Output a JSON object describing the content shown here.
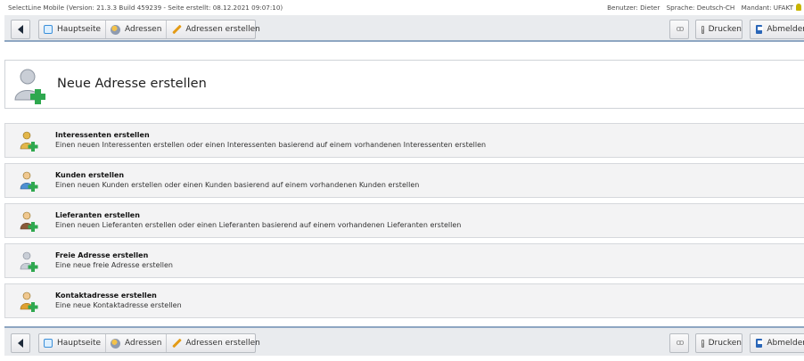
{
  "info_bar": {
    "version_text": "SelectLine Mobile (Version: 21.3.3 Build 459239 - Seite erstellt: 08.12.2021 09:07:10)",
    "user": "Benutzer: Dieter",
    "language": "Sprache: Deutsch-CH",
    "client": "Mandant: UFAKT"
  },
  "toolbar": {
    "home_label": "Hauptseite",
    "addresses_label": "Adressen",
    "create_addresses_label": "Adressen erstellen",
    "print_label": "Drucken",
    "logout_label": "Abmelden"
  },
  "page": {
    "title": "Neue Adresse erstellen"
  },
  "items": [
    {
      "title": "Interessenten erstellen",
      "desc": "Einen neuen Interessenten erstellen oder einen Interessenten basierend auf einem vorhandenen Interessenten erstellen",
      "figure_color": "#e3b64a"
    },
    {
      "title": "Kunden erstellen",
      "desc": "Einen neuen Kunden erstellen oder einen Kunden basierend auf einem vorhandenen Kunden erstellen",
      "figure_color": "#4f8fd2"
    },
    {
      "title": "Lieferanten erstellen",
      "desc": "Einen neuen Lieferanten erstellen oder einen Lieferanten basierend auf einem vorhandenen Lieferanten erstellen",
      "figure_color": "#8a5a3a"
    },
    {
      "title": "Freie Adresse erstellen",
      "desc": "Eine neue freie Adresse erstellen",
      "figure_color": "#9aa3ad"
    },
    {
      "title": "Kontaktadresse erstellen",
      "desc": "Eine neue Kontaktadresse erstellen",
      "figure_color": "#e0a030"
    }
  ],
  "colors": {
    "toolbar_bg": "#e9ebee",
    "toolbar_border": "#8ea6c2",
    "plus_green": "#2fa84f",
    "item_bg": "#f3f3f4"
  }
}
